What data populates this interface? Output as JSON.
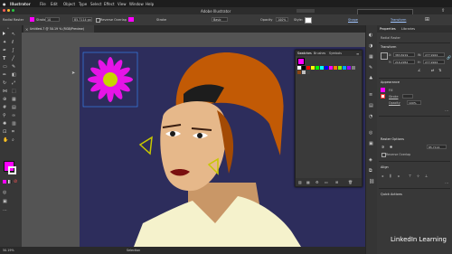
{
  "app": {
    "name": "Illustrator",
    "title": "Adobe Illustrator"
  },
  "menu": [
    "File",
    "Edit",
    "Object",
    "Type",
    "Select",
    "Effect",
    "View",
    "Window",
    "Help"
  ],
  "control": {
    "selection": "Radial Raster",
    "stroke_label": "Stroke:",
    "stroke_value": "10",
    "weight": "85.7114 px",
    "reverse_overlap": "Reverse Overlap",
    "stroke2_label": "Stroke",
    "basic": "Basic",
    "opacity_label": "Opacity",
    "opacity_value": "100%",
    "style_label": "Style:",
    "shape": "Shape",
    "transform": "Transform"
  },
  "doc_tab": "Untitled-7 @ 50.19 % (RGB/Preview)",
  "status": {
    "zoom": "50.19%",
    "mode": "Selection"
  },
  "swatches_panel": {
    "tabs": [
      "Swatches",
      "Brushes",
      "Symbols"
    ]
  },
  "properties": {
    "tabs": [
      "Properties",
      "Libraries"
    ],
    "object_type": "Radial Raster",
    "transform_title": "Transform",
    "x": "383.8219",
    "y": "216.2952",
    "w": "277.9924",
    "h": "277.9924",
    "appearance_title": "Appearance",
    "fill_label": "Fill",
    "stroke_label": "Stroke",
    "opacity_label": "Opacity",
    "opacity_value": "100%",
    "raster_title": "Raster Options",
    "raster_value": "85.7114",
    "reverse_label": "Reverse Overlap",
    "align_title": "Align",
    "quick_actions": "Quick Actions"
  },
  "colors": {
    "fill": "#ff00ff",
    "flower": "#e614e6",
    "center": "#c8d400",
    "artboard": "#2d2d5c",
    "hair": "#c25a05"
  },
  "watermark": "LinkedIn Learning"
}
